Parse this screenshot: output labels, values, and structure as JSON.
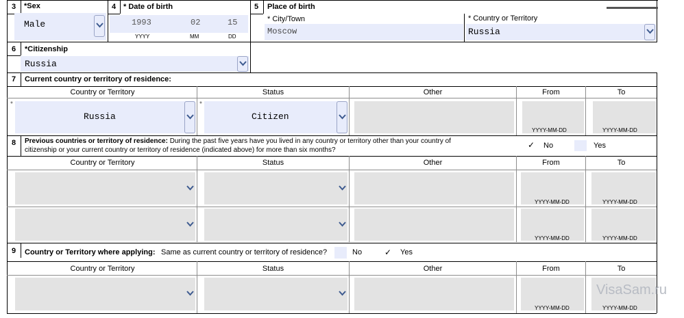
{
  "s3": {
    "num": "3",
    "label": "*Sex",
    "value": "Male"
  },
  "s4": {
    "num": "4",
    "label": "* Date of birth",
    "year": "1993",
    "month": "02",
    "day": "15",
    "year_hint": "YYYY",
    "month_hint": "MM",
    "day_hint": "DD"
  },
  "s5": {
    "num": "5",
    "label": "Place of birth",
    "city_label": "* City/Town",
    "city_value": "Moscow",
    "country_label": "* Country or Territory",
    "country_value": "Russia"
  },
  "s6": {
    "num": "6",
    "label": "*Citizenship",
    "value": "Russia"
  },
  "s7": {
    "num": "7",
    "label": "Current country or territory of residence:",
    "headers": [
      "Country or Territory",
      "Status",
      "Other",
      "From",
      "To"
    ],
    "country": "Russia",
    "status": "Citizen",
    "date_hint": "YYYY-MM-DD",
    "required_mark": "*"
  },
  "s8": {
    "num": "8",
    "label_bold": "Previous countries or territory of residence:",
    "label_rest": " During the past five years have you lived in any country or territory other than your country of",
    "label_line2": "citizenship or your current country or territory of residence (indicated above) for more than six months?",
    "no_label": "No",
    "yes_label": "Yes",
    "selected": "No",
    "check": "✓",
    "headers": [
      "Country or Territory",
      "Status",
      "Other",
      "From",
      "To"
    ],
    "date_hint": "YYYY-MM-DD"
  },
  "s9": {
    "num": "9",
    "label": "Country or Territory where applying:",
    "question": "Same as current country or territory of residence?",
    "no_label": "No",
    "yes_label": "Yes",
    "selected": "Yes",
    "check": "✓",
    "headers": [
      "Country or Territory",
      "Status",
      "Other",
      "From",
      "To"
    ],
    "date_hint": "YYYY-MM-DD"
  },
  "watermark": "VisaSam.ru",
  "colors": {
    "field_bg": "#e8ecfb",
    "grey_field_bg": "#e3e3e3",
    "chevron": "#3d5a8f"
  }
}
